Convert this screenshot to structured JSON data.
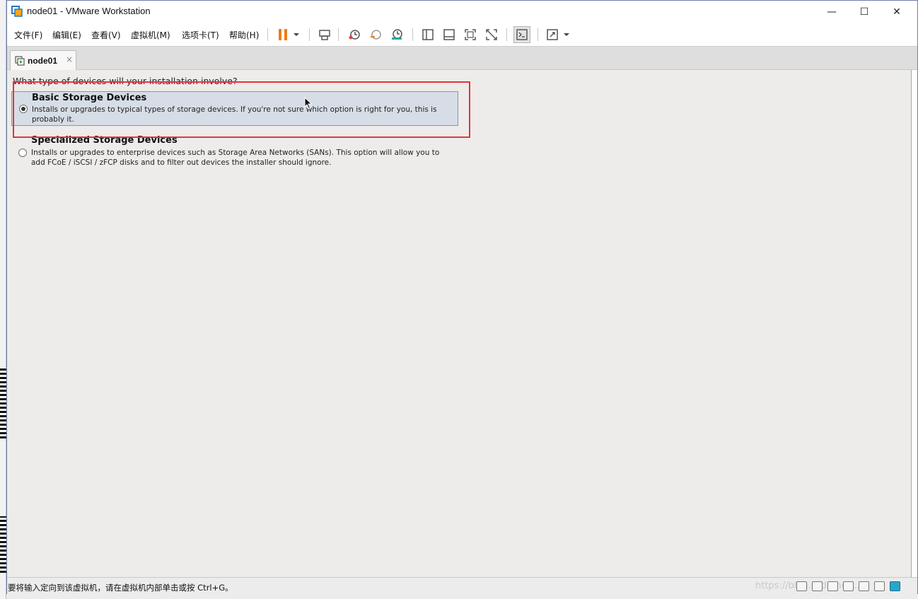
{
  "window": {
    "title": "node01 - VMware Workstation",
    "minimize_glyph": "—",
    "maximize_glyph": "☐",
    "close_glyph": "✕"
  },
  "menu": [
    {
      "label": "文件(F)"
    },
    {
      "label": "编辑(E)"
    },
    {
      "label": "查看(V)"
    },
    {
      "label": "虚拟机(M)"
    },
    {
      "label": "选项卡(T)"
    },
    {
      "label": "帮助(H)"
    }
  ],
  "toolbar_icons": [
    "pause-icon",
    "dropdown-arrow-icon",
    "send-ctrl-alt-del-icon",
    "snapshot-icon",
    "revert-snapshot-icon",
    "snapshot-manager-icon",
    "library-view-icon",
    "thumbnail-view-icon",
    "fullscreen-icon",
    "unity-icon",
    "console-icon",
    "stretch-icon",
    "dropdown-arrow-icon"
  ],
  "tab": {
    "label": "node01",
    "close_glyph": "×"
  },
  "installer": {
    "question": "What type of devices will your installation involve?",
    "options": [
      {
        "title": "Basic Storage Devices",
        "description": "Installs or upgrades to typical types of storage devices.  If you're not sure which option is right for you, this is probably it.",
        "selected": true
      },
      {
        "title": "Specialized Storage Devices",
        "description": "Installs or upgrades to enterprise devices such as Storage Area Networks (SANs). This option will allow you to add FCoE / iSCSI / zFCP disks and to filter out devices the installer should ignore.",
        "selected": false
      }
    ]
  },
  "status": {
    "message": "要将输入定向到该虚拟机，请在虚拟机内部单击或按 Ctrl+G。",
    "watermark": "https://blog.csdn.net/..."
  },
  "colors": {
    "highlight": "#e8323a",
    "pause": "#f07c1a",
    "selected_bg": "#d7dde6"
  }
}
